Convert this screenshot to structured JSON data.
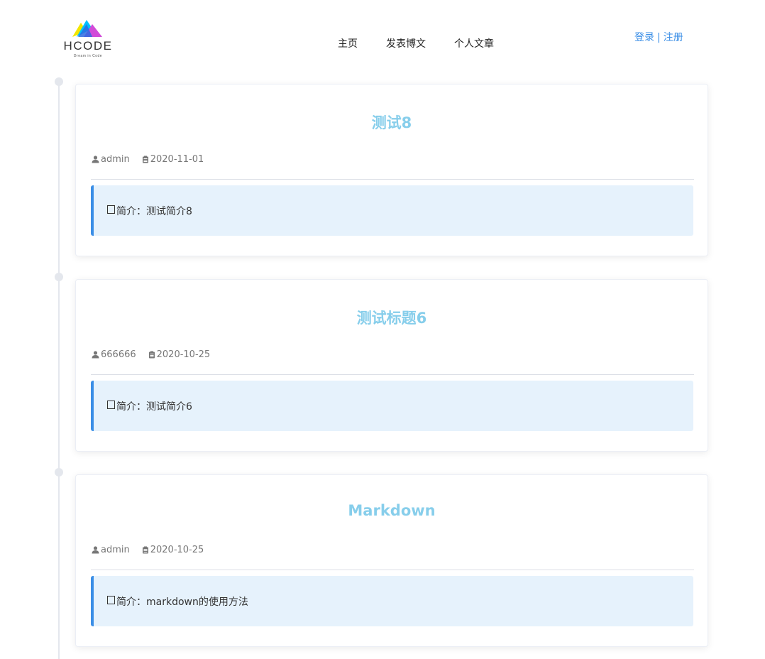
{
  "header": {
    "logo_text": "HCODE",
    "logo_sub": "Dream in Code",
    "nav": [
      "主页",
      "发表博文",
      "个人文章"
    ],
    "auth": {
      "login": "登录",
      "separator": "|",
      "register": "注册"
    }
  },
  "posts": [
    {
      "title": "测试8",
      "author": "admin",
      "date": "2020-11-01",
      "summary_label": "简介：",
      "summary": "测试简介8"
    },
    {
      "title": "测试标题6",
      "author": "666666",
      "date": "2020-10-25",
      "summary_label": "简介：",
      "summary": "测试简介6"
    },
    {
      "title": "Markdown",
      "author": "admin",
      "date": "2020-10-25",
      "summary_label": "简介：",
      "summary": "markdown的使用方法"
    }
  ],
  "colors": {
    "title": "#87ceeb",
    "accent": "#3a8ee6",
    "summary_bg": "#e6f2fc",
    "timeline": "#e4e7ed"
  },
  "icons": {
    "author": "user-icon",
    "date": "clipboard-icon",
    "summary": "box-icon"
  }
}
